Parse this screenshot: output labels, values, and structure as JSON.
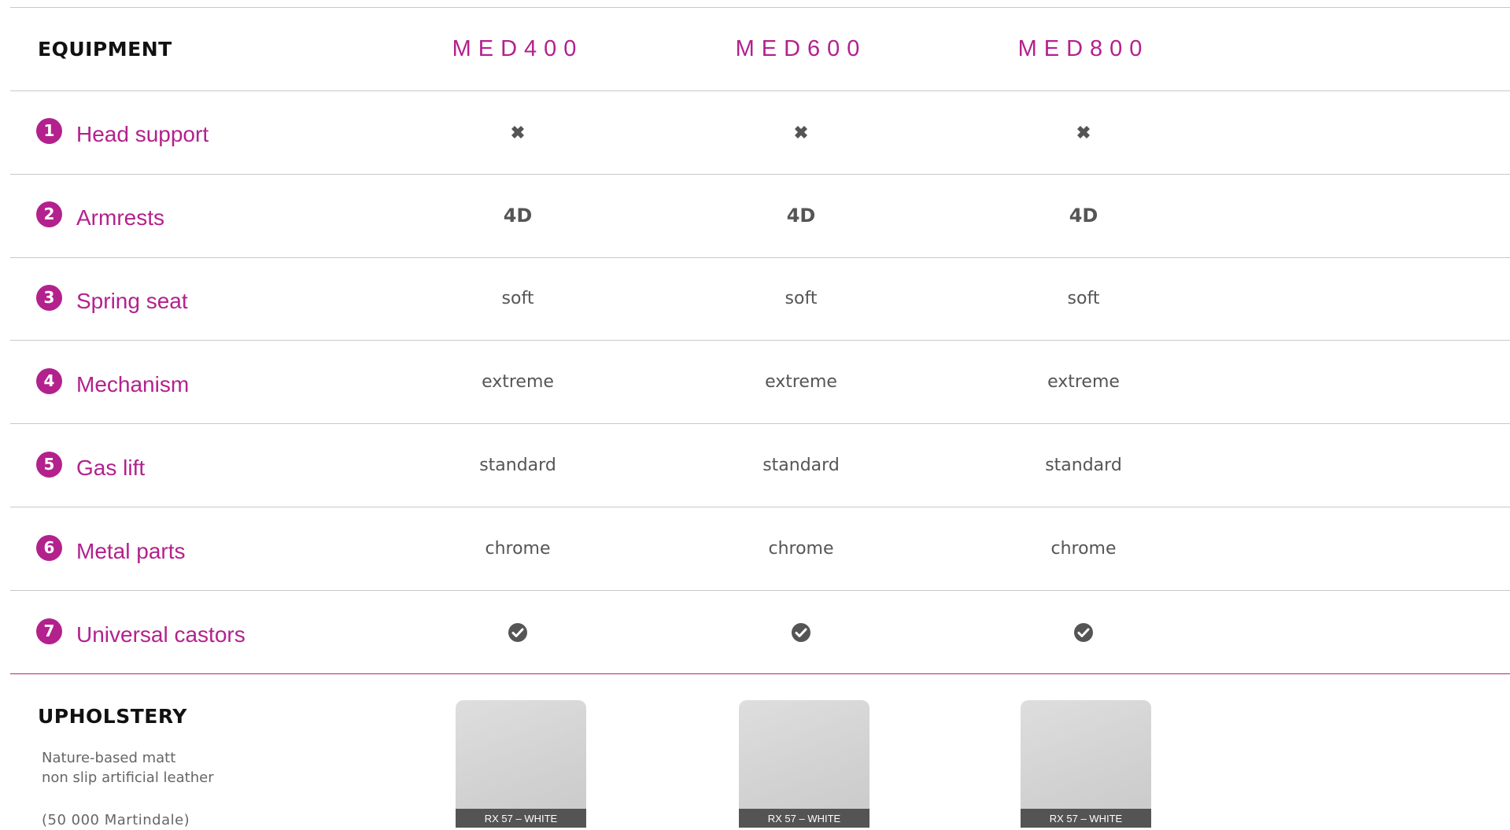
{
  "equipment": {
    "heading": "EQUIPMENT",
    "models": [
      "MED400",
      "MED600",
      "MED800"
    ],
    "rows": [
      {
        "number": "1",
        "label": "Head support",
        "kind": "cross-icon",
        "values": [
          "",
          "",
          ""
        ]
      },
      {
        "number": "2",
        "label": "Armrests",
        "kind": "bold-text",
        "values": [
          "4D",
          "4D",
          "4D"
        ]
      },
      {
        "number": "3",
        "label": "Spring seat",
        "kind": "text",
        "values": [
          "soft",
          "soft",
          "soft"
        ]
      },
      {
        "number": "4",
        "label": "Mechanism",
        "kind": "text",
        "values": [
          "extreme",
          "extreme",
          "extreme"
        ]
      },
      {
        "number": "5",
        "label": "Gas lift",
        "kind": "text",
        "values": [
          "standard",
          "standard",
          "standard"
        ]
      },
      {
        "number": "6",
        "label": "Metal parts",
        "kind": "text",
        "values": [
          "chrome",
          "chrome",
          "chrome"
        ]
      },
      {
        "number": "7",
        "label": "Universal castors",
        "kind": "check-icon",
        "values": [
          "",
          "",
          ""
        ]
      }
    ]
  },
  "upholstery": {
    "heading": "UPHOLSTERY",
    "description_line1": "Nature-based matt",
    "description_line2": "non slip artificial leather",
    "martindale": "(50 000 Martindale)",
    "swatches": [
      "RX 57 – WHITE",
      "RX 57 – WHITE",
      "RX 57 – WHITE"
    ]
  },
  "colors": {
    "accent": "#b3218d",
    "divider": "#c8c8c8",
    "text": "#555555",
    "swatch_caption_bg": "#545454"
  }
}
